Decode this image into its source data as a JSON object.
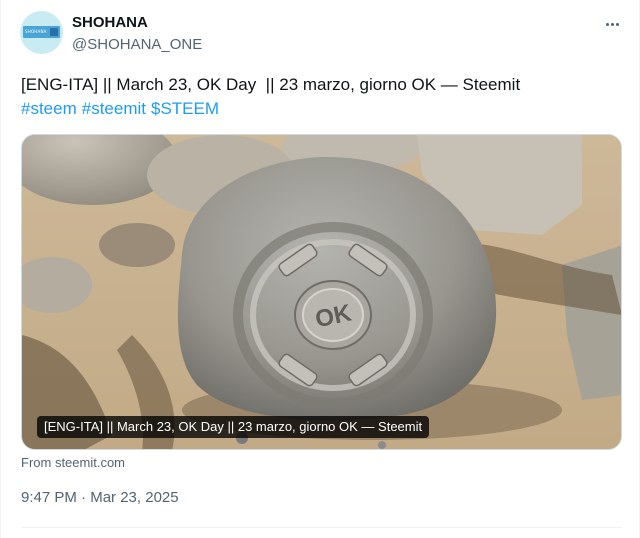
{
  "author": {
    "display_name": "SHOHANA",
    "handle": "@SHOHANA_ONE",
    "avatar_label": "SHOHANA"
  },
  "tweet": {
    "text": "[ENG-ITA] || March 23, OK Day  || 23 marzo, giorno OK — Steemit",
    "hashtags": [
      "#steem",
      "#steemit",
      "$STEEM"
    ]
  },
  "card": {
    "caption": "[ENG-ITA] || March 23, OK Day || 23 marzo, giorno OK — Steemit",
    "stone_text": "OK",
    "source": "From steemit.com"
  },
  "meta": {
    "time": "9:47 PM",
    "separator": "·",
    "date": "Mar 23, 2025"
  },
  "icons": {
    "more": "more-horizontal-icon"
  },
  "colors": {
    "link": "#1d9bf0",
    "secondary_text": "#536471",
    "primary_text": "#0f1419"
  }
}
